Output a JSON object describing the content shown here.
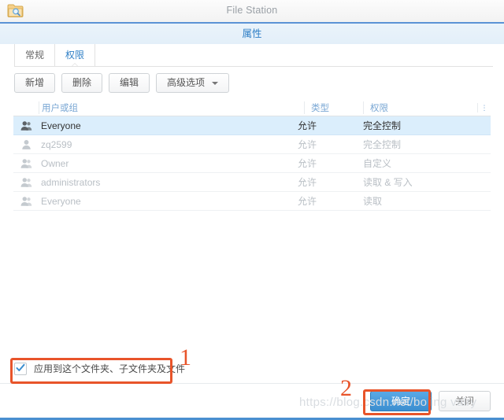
{
  "window": {
    "app_title": "File Station",
    "app_icon": "folder-search-icon"
  },
  "dialog": {
    "title": "属性"
  },
  "tabs": [
    {
      "label": "常规",
      "active": false
    },
    {
      "label": "权限",
      "active": true
    }
  ],
  "toolbar": {
    "add_label": "新增",
    "delete_label": "删除",
    "edit_label": "编辑",
    "advanced_label": "高级选项"
  },
  "table": {
    "columns": [
      "用户或组",
      "类型",
      "权限"
    ],
    "menu_icon": "column-options-icon",
    "rows": [
      {
        "name": "Everyone",
        "type": "允许",
        "permission": "完全控制",
        "icon": "group-icon",
        "selected": true
      },
      {
        "name": "zq2599",
        "type": "允许",
        "permission": "完全控制",
        "icon": "user-icon",
        "selected": false
      },
      {
        "name": "Owner",
        "type": "允许",
        "permission": "自定义",
        "icon": "group-icon",
        "selected": false
      },
      {
        "name": "administrators",
        "type": "允许",
        "permission": "读取 & 写入",
        "icon": "group-icon",
        "selected": false
      },
      {
        "name": "Everyone",
        "type": "允许",
        "permission": "读取",
        "icon": "group-icon",
        "selected": false
      }
    ]
  },
  "footer": {
    "apply_checkbox_label": "应用到这个文件夹、子文件夹及文件",
    "apply_checkbox_checked": true,
    "confirm_label": "确定",
    "close_label": "关闭"
  },
  "annotations": {
    "step_one": "1",
    "step_two": "2",
    "box_color": "#e8542a"
  },
  "watermark": {
    "text": "https://blog.csdn.net/bo  ing        valry"
  }
}
